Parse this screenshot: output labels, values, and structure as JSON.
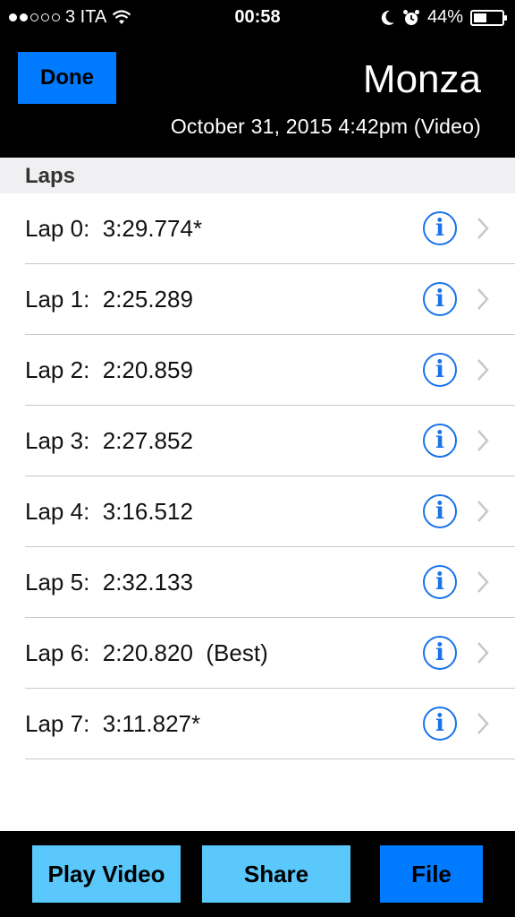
{
  "status_bar": {
    "carrier": "3 ITA",
    "signal_filled": 2,
    "signal_total": 5,
    "time": "00:58",
    "battery_percent": "44%",
    "battery_level": 0.44,
    "icons": [
      "wifi-icon",
      "moon-icon",
      "alarm-icon",
      "battery-icon"
    ]
  },
  "header": {
    "done_label": "Done",
    "title": "Monza",
    "subtitle": "October 31, 2015 4:42pm  (Video)"
  },
  "section": {
    "title": "Laps"
  },
  "laps": [
    {
      "label": "Lap 0:  3:29.774*"
    },
    {
      "label": "Lap 1:  2:25.289"
    },
    {
      "label": "Lap 2:  2:20.859"
    },
    {
      "label": "Lap 3:  2:27.852"
    },
    {
      "label": "Lap 4:  3:16.512"
    },
    {
      "label": "Lap 5:  2:32.133"
    },
    {
      "label": "Lap 6:  2:20.820  (Best)"
    },
    {
      "label": "Lap 7:  3:11.827*"
    }
  ],
  "info_glyph": "i",
  "toolbar": {
    "play_label": "Play Video",
    "share_label": "Share",
    "file_label": "File"
  },
  "colors": {
    "accent": "#007AFF",
    "light_button": "#5AC8FA",
    "info_blue": "#1a73e8"
  }
}
